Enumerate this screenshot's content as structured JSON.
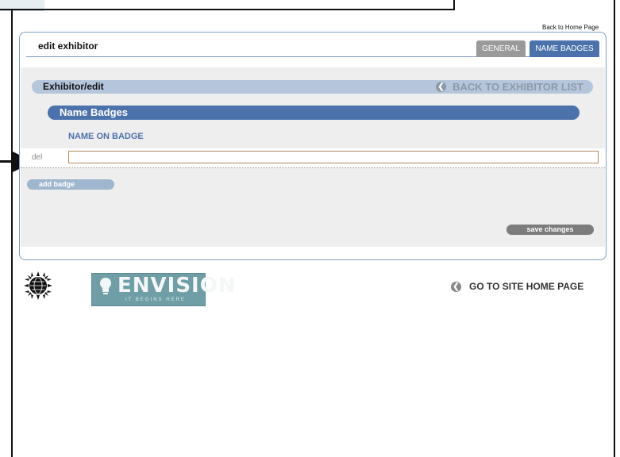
{
  "header": {
    "back_home": "Back to Home Page",
    "title": "edit exhibitor"
  },
  "tabs": [
    {
      "label": "GENERAL"
    },
    {
      "label": "NAME BADGES"
    }
  ],
  "section": {
    "title": "Exhibitor/edit",
    "back_link": "BACK TO EXHIBITOR LIST"
  },
  "badges": {
    "title": "Name Badges",
    "column_header": "NAME ON BADGE",
    "rows": [
      {
        "delete_label": "del",
        "value": ""
      }
    ],
    "add_label": "add badge",
    "save_label": "save changes"
  },
  "footer": {
    "logo_word": "ENVISION",
    "logo_tagline": "IT BEGINS HERE",
    "site_home": "GO TO SITE HOME PAGE"
  },
  "icons": {
    "back_list": "back-arrow-icon",
    "site_home": "back-arrow-icon",
    "globe": "globe-sun-icon",
    "bulb": "lightbulb-icon",
    "annotation": "pointer-arrow-icon"
  },
  "colors": {
    "accent": "#4c72ac",
    "tab_inactive": "#9a9a9a",
    "section_bar": "#b5c6dc",
    "logo_bg": "#6f9ea6"
  }
}
